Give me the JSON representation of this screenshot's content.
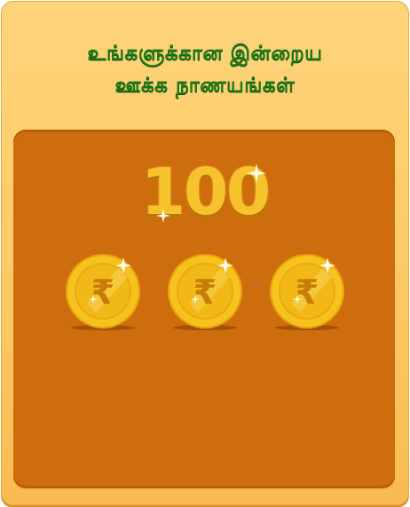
{
  "header": {
    "title_line1": "உங்களுக்கான இன்றைய",
    "title_line2": "ஊக்க நாணயங்கள்"
  },
  "reward": {
    "amount": "100",
    "coin_count": 3,
    "currency_symbol": "₹"
  },
  "colors": {
    "card_bg": "#fcc865",
    "panel_bg": "#cd6d0d",
    "title_green": "#1f7a1a",
    "coin_gold": "#f0b812"
  }
}
